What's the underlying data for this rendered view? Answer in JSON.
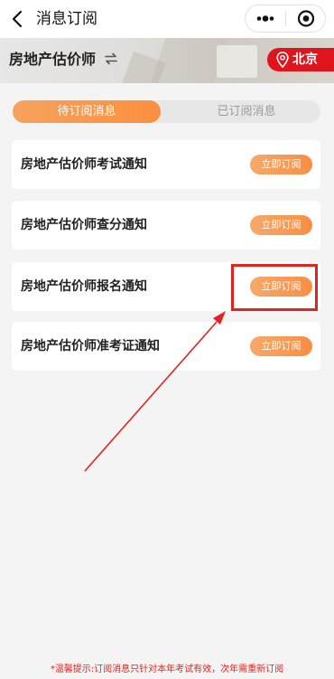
{
  "navbar": {
    "title": "消息订阅",
    "back_icon": "chevron-left-icon",
    "more_icon": "more-dots-icon",
    "close_icon": "target-close-icon"
  },
  "banner": {
    "exam_title": "房地产估价师",
    "switch_icon": "swap-arrows-icon",
    "city_icon": "location-pin-icon",
    "city": "北京"
  },
  "tabs": [
    {
      "label": "待订阅消息",
      "active": true
    },
    {
      "label": "已订阅消息",
      "active": false
    }
  ],
  "subscriptions": [
    {
      "title": "房地产估价师考试通知",
      "button": "立即订阅"
    },
    {
      "title": "房地产估价师查分通知",
      "button": "立即订阅"
    },
    {
      "title": "房地产估价师报名通知",
      "button": "立即订阅"
    },
    {
      "title": "房地产估价师准考证通知",
      "button": "立即订阅"
    }
  ],
  "tip": "*温馨提示:订阅消息只针对本年考试有效，次年需重新订阅",
  "colors": {
    "accent_orange": "#fb8f3f",
    "brand_red": "#e0141d",
    "annotation_red": "#e3231e"
  }
}
